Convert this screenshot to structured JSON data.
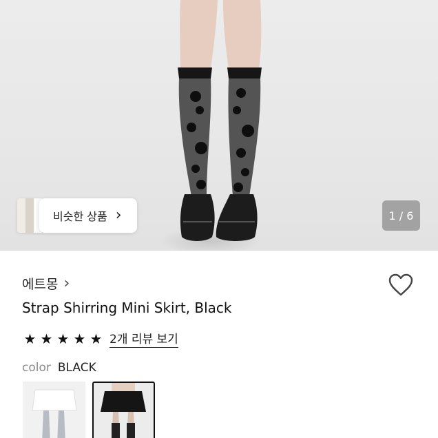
{
  "hero": {
    "image_icon": "product-photo-knee-high-floral-sheer-socks",
    "similar_label": "비슷한 상품",
    "similar_chevron": "›",
    "counter": "1 / 6"
  },
  "product": {
    "brand": "에트몽",
    "brand_chevron": "›",
    "title": "Strap Shirring Mini Skirt, Black",
    "rating_stars": 5,
    "reviews_link": "2개 리뷰 보기",
    "color_label": "color",
    "color_value": "BLACK",
    "variants": [
      {
        "name": "white-variant-thumbnail",
        "selected": false
      },
      {
        "name": "black-variant-thumbnail",
        "selected": true
      }
    ]
  },
  "colors": {
    "star": "#111111",
    "selected_border": "#111111",
    "muted": "#8a8a8a"
  }
}
